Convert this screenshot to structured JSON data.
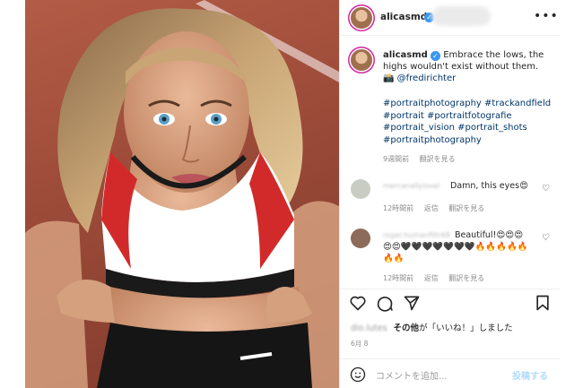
{
  "post": {
    "username": "alicasmd",
    "caption": "Embrace the lows, the highs wouldn't exist without them.",
    "camera_emoji": "📸",
    "mention": "@fredirichter",
    "hashtags": "#portraitphotography #trackandfield #portrait #portraitfotografie #portrait_vision #portrait_shots #portraitphotography",
    "caption_age": "9週間前",
    "see_translation": "翻訳を見る"
  },
  "comments": [
    {
      "username": "mercanallylovel",
      "text": "Damn, this eyes😍",
      "age": "12時間前",
      "reply": "返信",
      "translate": "翻訳を見る",
      "avatar_color": "#c9ccc2"
    },
    {
      "username": "roger.humanfiltr68",
      "text": "Beautiful!😍😍😍😍😍🖤🖤🖤🖤🖤🖤🖤🔥🔥🔥🔥🔥🔥🔥",
      "age": "12時間前",
      "reply": "返信",
      "translate": "翻訳を見る",
      "avatar_color": "#8c6b5a"
    }
  ],
  "likes": {
    "liker": "dio.lutes",
    "others": "その他",
    "suffix": "が「いいね！」しました"
  },
  "date": "6月 8",
  "composer": {
    "placeholder": "コメントを追加...",
    "post_label": "投稿する"
  },
  "icons": {
    "like": "heart-icon",
    "comment": "comment-icon",
    "share": "share-icon",
    "save": "bookmark-icon",
    "more": "more-icon",
    "emoji": "emoji-icon"
  },
  "colors": {
    "link": "#00376b",
    "verified": "#3897f0",
    "meta": "#8e8e8e",
    "post_disabled": "#b3dbff"
  }
}
